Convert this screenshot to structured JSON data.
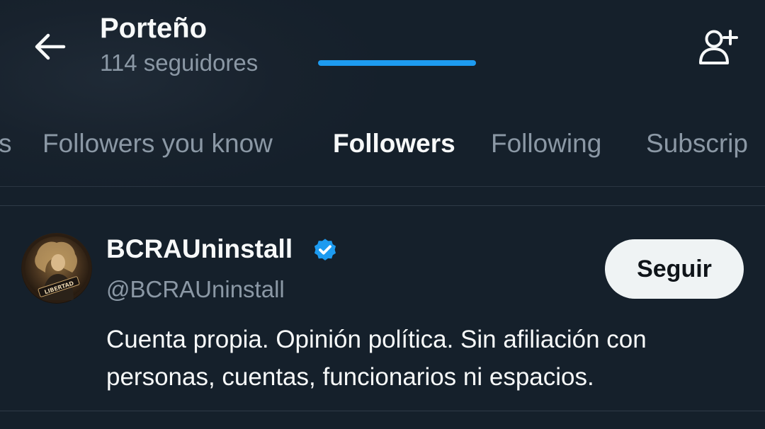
{
  "header": {
    "title": "Porteño",
    "subtitle": "114 seguidores"
  },
  "tabs": [
    {
      "label": "s",
      "active": false
    },
    {
      "label": "Followers you know",
      "active": false
    },
    {
      "label": "Followers",
      "active": true
    },
    {
      "label": "Following",
      "active": false
    },
    {
      "label": "Subscrip",
      "active": false
    }
  ],
  "user": {
    "display_name": "BCRAUninstall",
    "handle": "@BCRAUninstall",
    "verified": true,
    "follow_label": "Seguir",
    "bio": "Cuenta propia. Opinión política. Sin afiliación con personas, cuentas, funcionarios ni espacios.",
    "avatar_text": "LIBERTAD"
  },
  "icons": {
    "back": "arrow-left-icon",
    "add_user": "person-add-icon",
    "verified": "verified-badge-icon"
  },
  "colors": {
    "background": "#15202b",
    "accent": "#1d9bf0",
    "text_primary": "#f7f9f9",
    "text_secondary": "#8b98a5",
    "button_bg": "#eff3f4"
  }
}
